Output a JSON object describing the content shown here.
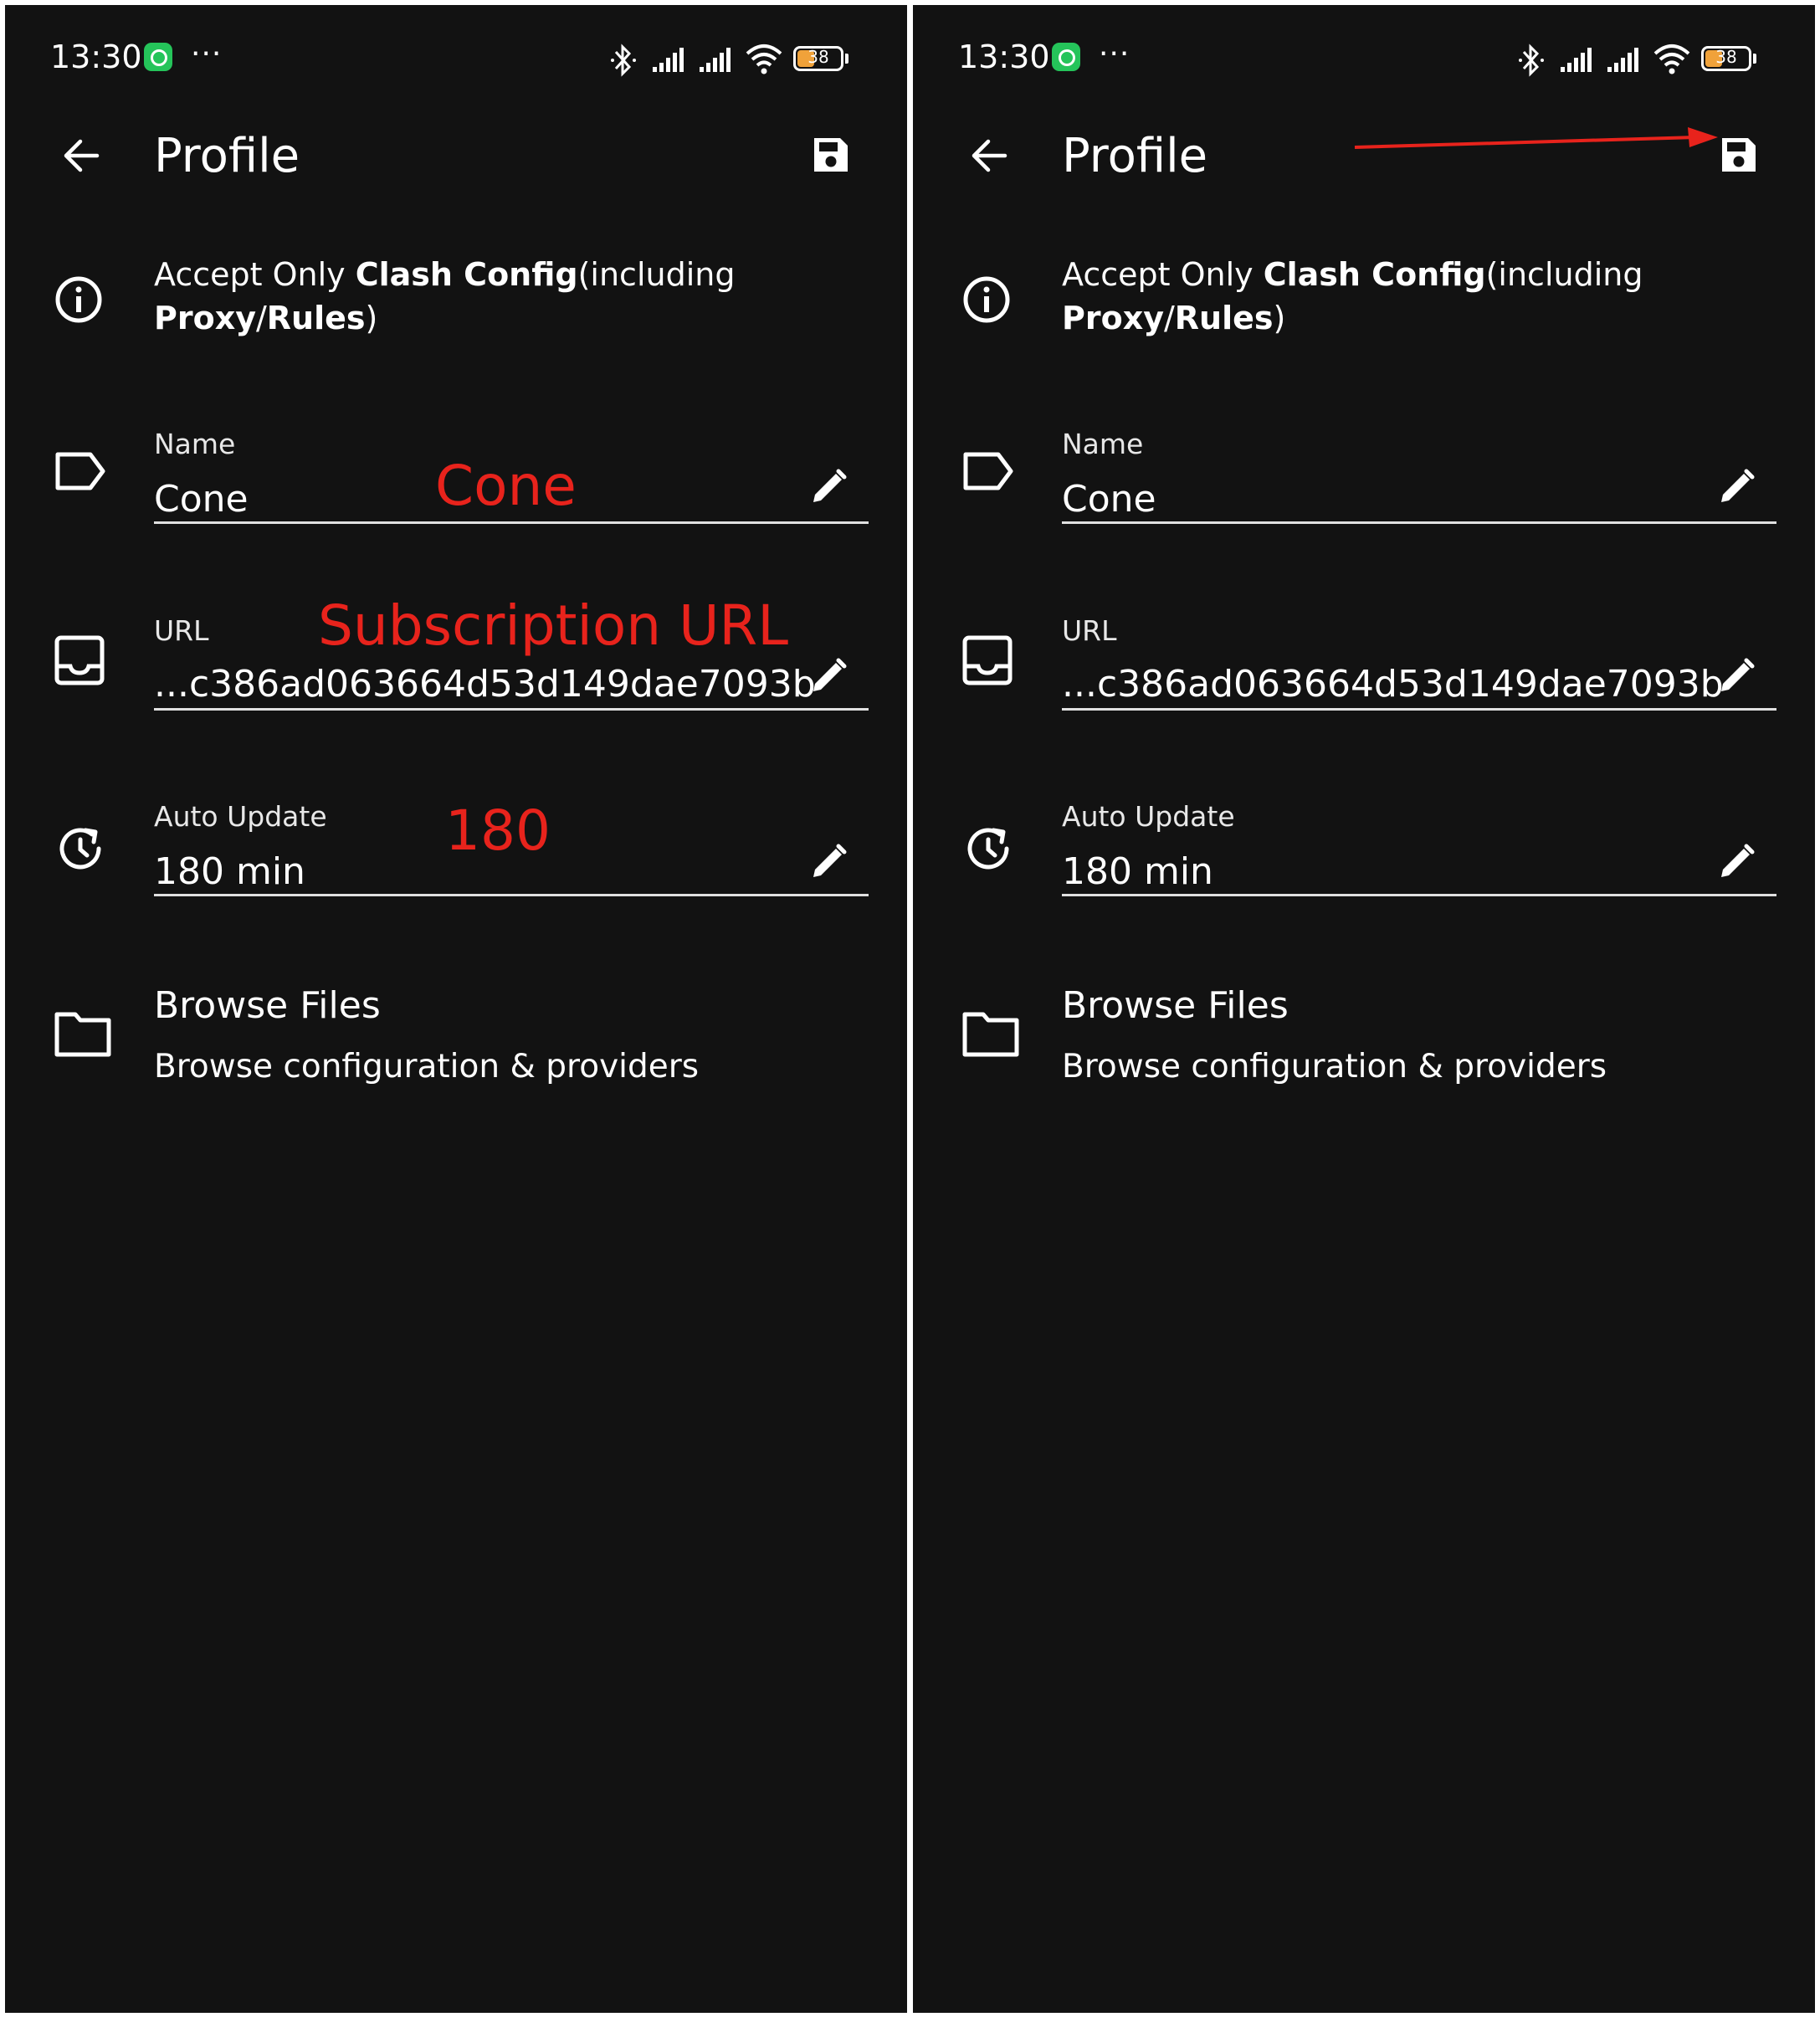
{
  "status_bar": {
    "time": "13:30",
    "more": "···",
    "battery": "38",
    "icons": [
      "whatsapp-icon",
      "bluetooth-icon",
      "signal-icon",
      "signal-icon",
      "wifi-icon",
      "battery-icon"
    ]
  },
  "toolbar": {
    "title": "Profile",
    "back_icon": "arrow-left-icon",
    "save_icon": "floppy-disk-icon"
  },
  "info": {
    "text_parts": [
      "Accept Only ",
      "Clash Config",
      "(including ",
      "Proxy",
      "/",
      "Rules",
      ")"
    ]
  },
  "fields": {
    "name": {
      "label": "Name",
      "value": "Cone"
    },
    "url": {
      "label": "URL",
      "value": "...c386ad063664d53d149dae7093b"
    },
    "auto_update": {
      "label": "Auto Update",
      "value": "180 min"
    }
  },
  "browse_files": {
    "title": "Browse Files",
    "subtitle": "Browse configuration & providers"
  },
  "annotations": {
    "name": "Cone",
    "url": "Subscription URL",
    "auto_update": "180",
    "color": "#e8231c"
  },
  "colors": {
    "background": "#121212",
    "text": "#ffffff",
    "whatsapp_green": "#25c45a",
    "battery_fill": "#f0a23a"
  }
}
